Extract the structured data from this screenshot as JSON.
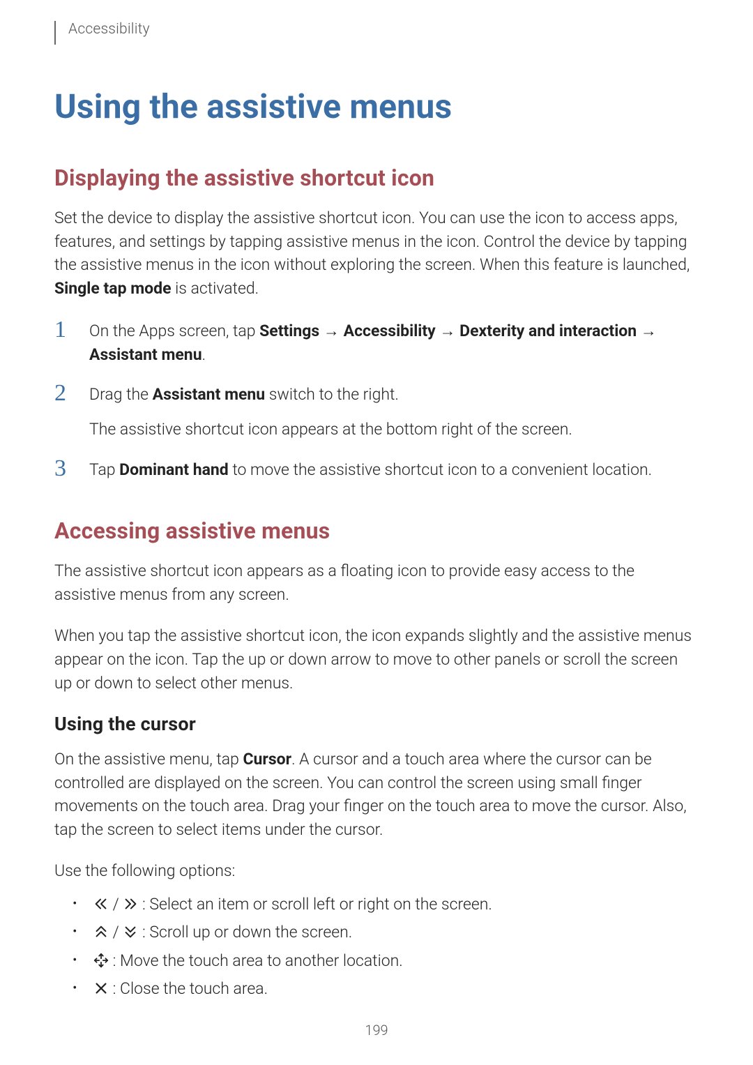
{
  "breadcrumb": "Accessibility",
  "h1": "Using the assistive menus",
  "section1": {
    "heading": "Displaying the assistive shortcut icon",
    "intro_parts": {
      "t1": "Set the device to display the assistive shortcut icon. You can use the icon to access apps, features, and settings by tapping assistive menus in the icon. Control the device by tapping the assistive menus in the icon without exploring the screen. When this feature is launched, ",
      "b1": "Single tap mode",
      "t2": " is activated."
    },
    "steps": [
      {
        "num": "1",
        "parts": {
          "t1": "On the Apps screen, tap ",
          "b1": "Settings",
          "arr1": " → ",
          "b2": "Accessibility",
          "arr2": " → ",
          "b3": "Dexterity and interaction",
          "arr3": " → ",
          "b4": "Assistant menu",
          "t2": "."
        }
      },
      {
        "num": "2",
        "parts": {
          "t1": "Drag the ",
          "b1": "Assistant menu",
          "t2": " switch to the right."
        },
        "sub": "The assistive shortcut icon appears at the bottom right of the screen."
      },
      {
        "num": "3",
        "parts": {
          "t1": "Tap ",
          "b1": "Dominant hand",
          "t2": " to move the assistive shortcut icon to a convenient location."
        }
      }
    ]
  },
  "section2": {
    "heading": "Accessing assistive menus",
    "p1": "The assistive shortcut icon appears as a floating icon to provide easy access to the assistive menus from any screen.",
    "p2": "When you tap the assistive shortcut icon, the icon expands slightly and the assistive menus appear on the icon. Tap the up or down arrow to move to other panels or scroll the screen up or down to select other menus.",
    "sub": {
      "heading": "Using the cursor",
      "p1_parts": {
        "t1": "On the assistive menu, tap ",
        "b1": "Cursor",
        "t2": ". A cursor and a touch area where the cursor can be controlled are displayed on the screen. You can control the screen using small finger movements on the touch area. Drag your finger on the touch area to move the cursor. Also, tap the screen to select items under the cursor."
      },
      "p2": "Use the following options:",
      "bullets": [
        {
          "icons": [
            "double-chevron-left",
            "double-chevron-right"
          ],
          "sep": " / ",
          "text": " : Select an item or scroll left or right on the screen."
        },
        {
          "icons": [
            "double-chevron-up",
            "double-chevron-down"
          ],
          "sep": " / ",
          "text": " : Scroll up or down the screen."
        },
        {
          "icons": [
            "move-arrows"
          ],
          "sep": "",
          "text": " : Move the touch area to another location."
        },
        {
          "icons": [
            "close-x"
          ],
          "sep": "",
          "text": " : Close the touch area."
        }
      ]
    }
  },
  "page_number": "199"
}
